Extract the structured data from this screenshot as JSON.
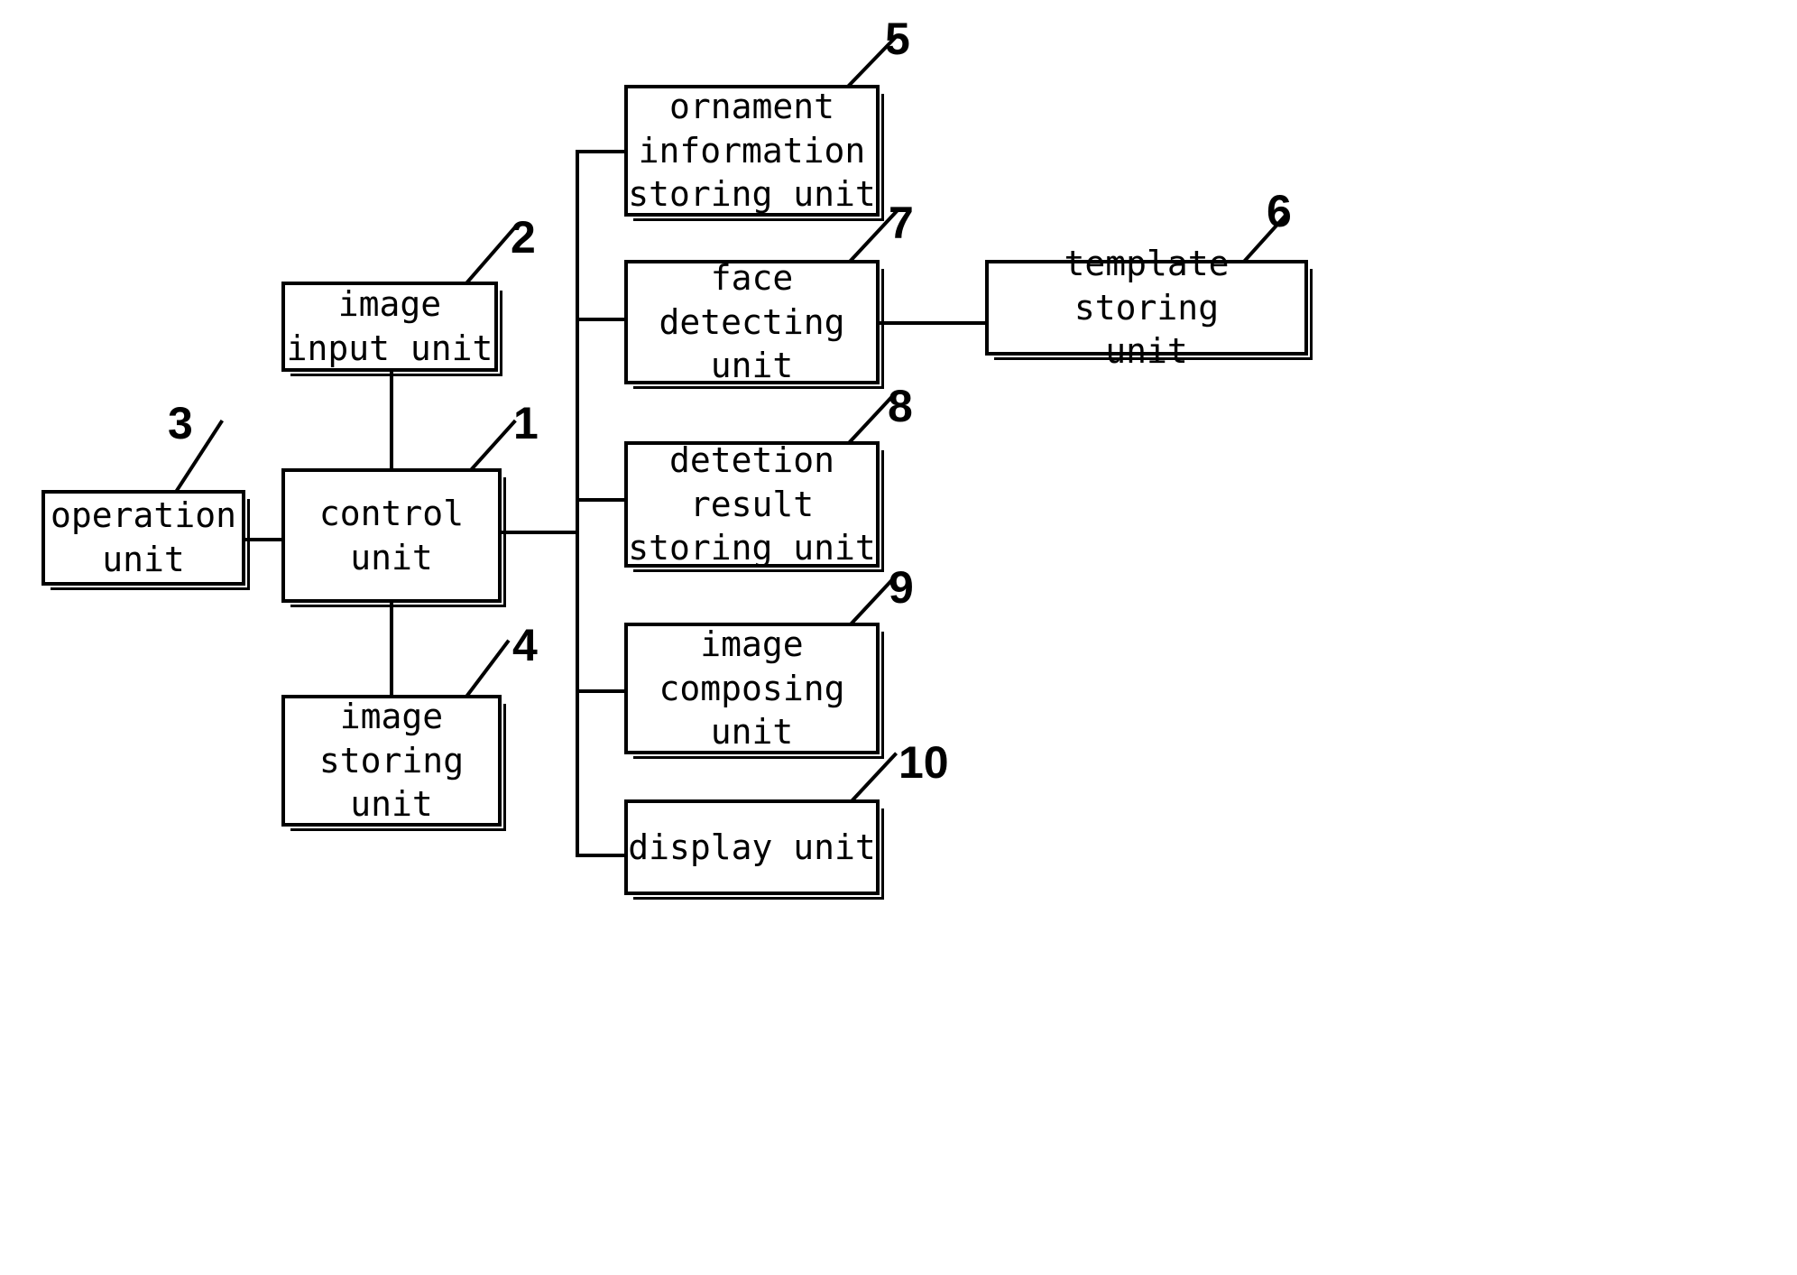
{
  "figure": {
    "type": "patent-block-diagram",
    "background_color": "#ffffff",
    "line_color": "#000000"
  },
  "blocks": {
    "image_input_unit": {
      "label": "image\ninput unit",
      "ref": "2"
    },
    "operation_unit": {
      "label": "operation\nunit",
      "ref": "3"
    },
    "control_unit": {
      "label": "control\nunit",
      "ref": "1"
    },
    "image_storing_unit": {
      "label": "image\nstoring\nunit",
      "ref": "4"
    },
    "ornament_information_storing_unit": {
      "label": "ornament\ninformation\nstoring unit",
      "ref": "5"
    },
    "face_detecting_unit": {
      "label": "face\ndetecting\nunit",
      "ref": "7"
    },
    "template_storing_unit": {
      "label": "template storing\nunit",
      "ref": "6"
    },
    "detection_result_storing_unit": {
      "label": "detetion\nresult\nstoring unit",
      "ref": "8"
    },
    "image_composing_unit": {
      "label": "image\ncomposing\nunit",
      "ref": "9"
    },
    "display_unit": {
      "label": "display unit",
      "ref": "10"
    }
  },
  "reference_numerals": {
    "n1": "1",
    "n2": "2",
    "n3": "3",
    "n4": "4",
    "n5": "5",
    "n6": "6",
    "n7": "7",
    "n8": "8",
    "n9": "9",
    "n10": "10"
  }
}
